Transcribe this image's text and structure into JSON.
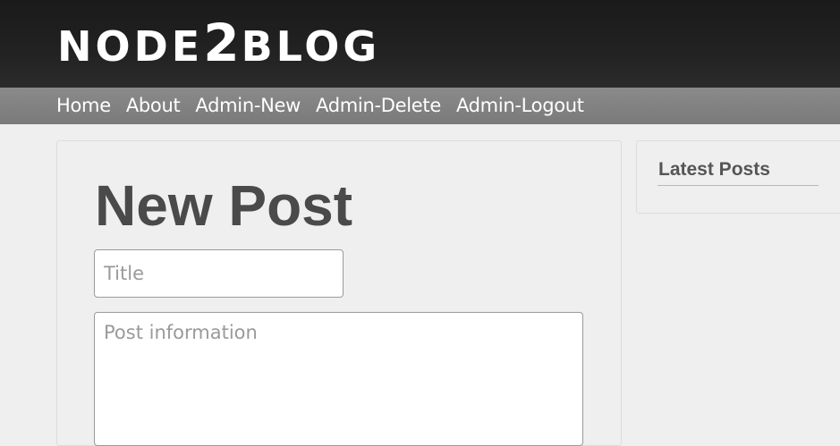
{
  "header": {
    "logo_prefix": "NODE",
    "logo_number": "2",
    "logo_suffix": "BLOG"
  },
  "nav": {
    "items": [
      {
        "label": "Home"
      },
      {
        "label": "About"
      },
      {
        "label": "Admin-New"
      },
      {
        "label": "Admin-Delete"
      },
      {
        "label": "Admin-Logout"
      }
    ]
  },
  "main": {
    "title": "New Post",
    "title_field": {
      "value": "",
      "placeholder": "Title"
    },
    "body_field": {
      "value": "",
      "placeholder": "Post information"
    }
  },
  "sidebar": {
    "heading": "Latest Posts"
  },
  "colors": {
    "header_bg": "#1e1e1e",
    "nav_bg": "#828282",
    "page_bg": "#efefef",
    "title_text": "#4a4a4a"
  }
}
